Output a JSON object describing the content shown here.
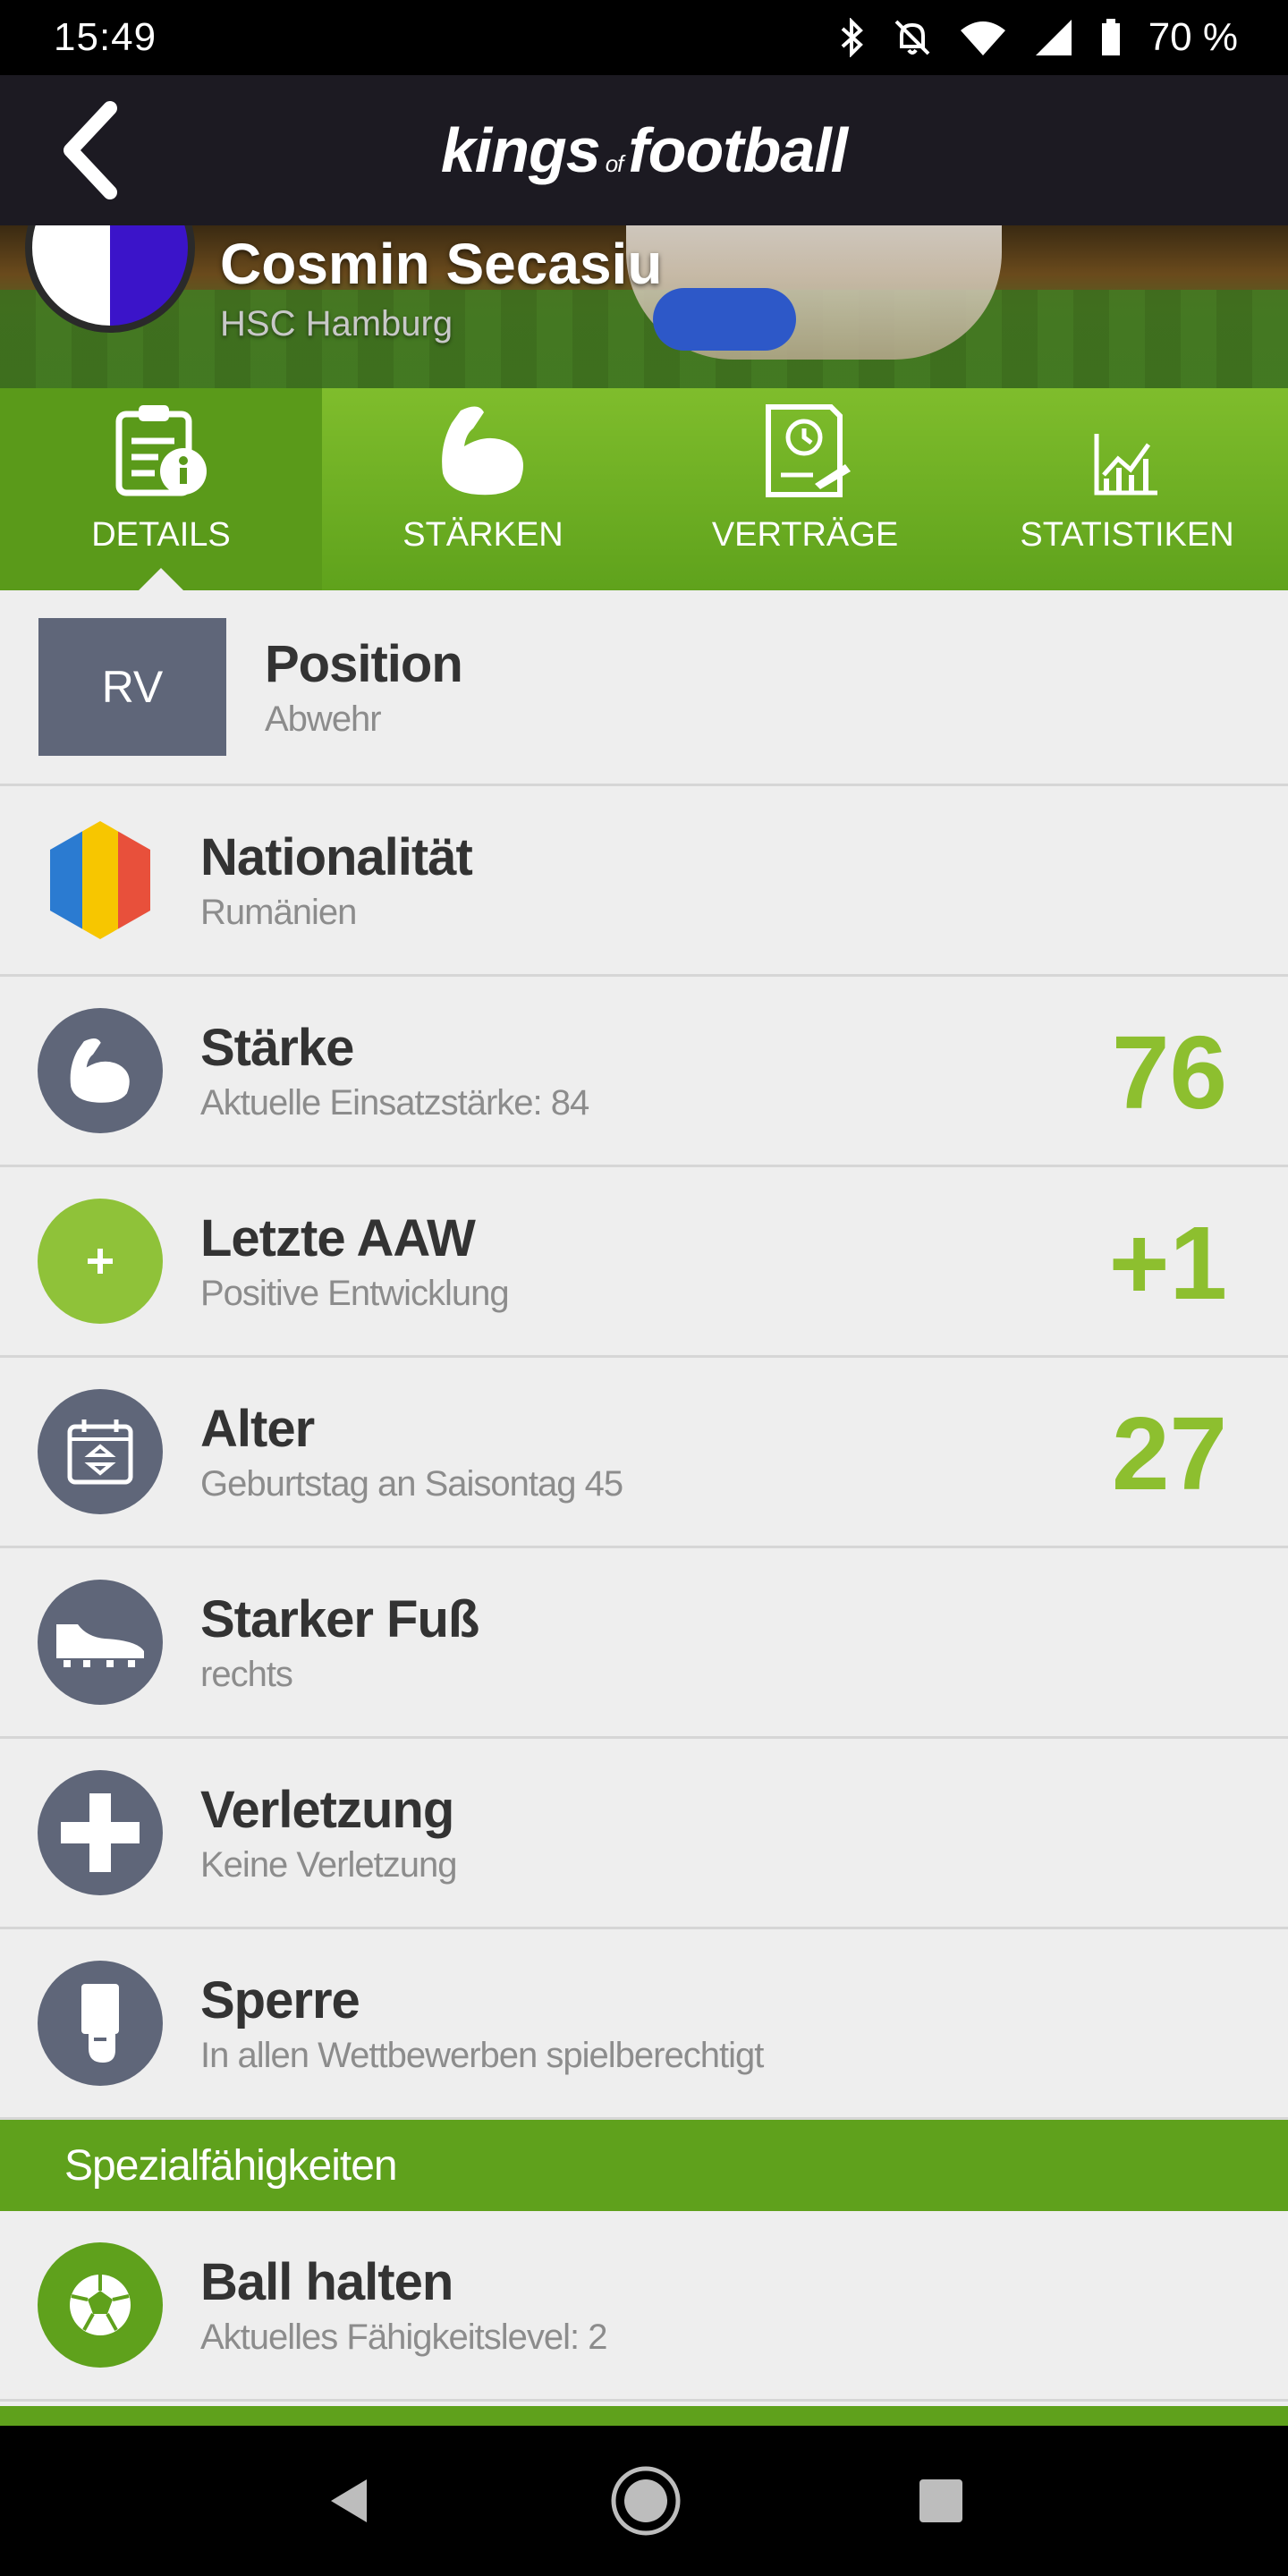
{
  "status": {
    "time": "15:49",
    "battery": "70 %"
  },
  "header": {
    "logo_part1": "kings",
    "logo_of": "of",
    "logo_part2": "football"
  },
  "player": {
    "name": "Cosmin Secasiu",
    "club": "HSC Hamburg"
  },
  "tabs": [
    {
      "label": "DETAILS",
      "active": true
    },
    {
      "label": "STÄRKEN",
      "active": false
    },
    {
      "label": "VERTRÄGE",
      "active": false
    },
    {
      "label": "STATISTIKEN",
      "active": false
    }
  ],
  "details": {
    "position": {
      "code": "RV",
      "title": "Position",
      "sub": "Abwehr"
    },
    "nationality": {
      "title": "Nationalität",
      "sub": "Rumänien"
    },
    "strength": {
      "title": "Stärke",
      "sub": "Aktuelle Einsatzstärke: 84",
      "value": "76"
    },
    "last_aaw": {
      "title": "Letzte AAW",
      "sub": "Positive Entwicklung",
      "value": "+1"
    },
    "age": {
      "title": "Alter",
      "sub": "Geburtstag an Saisontag 45",
      "value": "27"
    },
    "foot": {
      "title": "Starker Fuß",
      "sub": "rechts"
    },
    "injury": {
      "title": "Verletzung",
      "sub": "Keine Verletzung"
    },
    "suspension": {
      "title": "Sperre",
      "sub": "In allen Wettbewerben spielberechtigt"
    }
  },
  "special": {
    "header": "Spezialfähigkeiten",
    "items": [
      {
        "title": "Ball halten",
        "sub": "Aktuelles Fähigkeitslevel: 2"
      }
    ]
  },
  "colors": {
    "accent": "#8dbf2f",
    "green": "#5fa11c",
    "icon_bg": "#5f6679",
    "header_bg": "#1c1a22"
  },
  "icons": [
    "bluetooth-icon",
    "mute-icon",
    "wifi-icon",
    "signal-icon",
    "battery-icon",
    "back-arrow-icon",
    "details-icon",
    "muscle-icon",
    "contract-icon",
    "statistics-icon",
    "flag-icon",
    "calendar-icon",
    "boot-icon",
    "cross-icon",
    "card-icon",
    "ball-icon",
    "nav-back-icon",
    "nav-home-icon",
    "nav-recent-icon"
  ]
}
